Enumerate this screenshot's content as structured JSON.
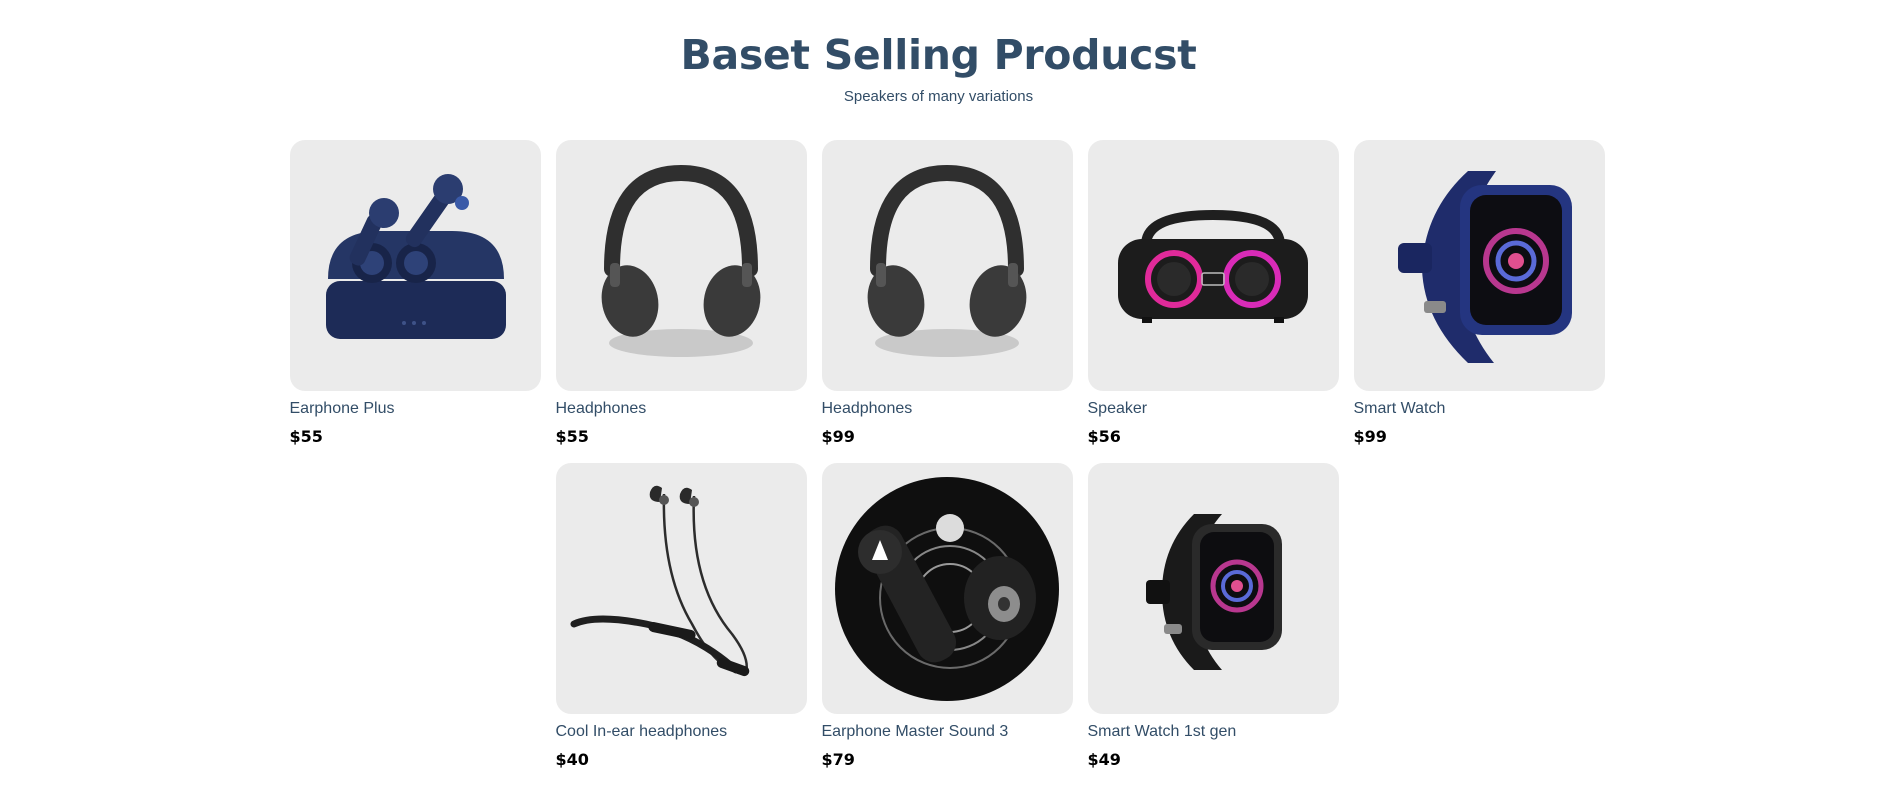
{
  "header": {
    "title": "Baset Selling Producst",
    "subtitle": "Speakers of many variations"
  },
  "products": [
    {
      "name": "Earphone Plus",
      "price": "$55",
      "icon": "earbuds-case-icon"
    },
    {
      "name": "Headphones",
      "price": "$55",
      "icon": "headphones-icon"
    },
    {
      "name": "Headphones",
      "price": "$99",
      "icon": "headphones-icon"
    },
    {
      "name": "Speaker",
      "price": "$56",
      "icon": "speaker-icon"
    },
    {
      "name": "Smart Watch",
      "price": "$99",
      "icon": "smartwatch-icon"
    },
    {
      "name": "Cool In-ear headphones",
      "price": "$40",
      "icon": "neckband-earphones-icon"
    },
    {
      "name": "Earphone Master Sound 3",
      "price": "$79",
      "icon": "earbuds-icon"
    },
    {
      "name": "Smart Watch 1st gen",
      "price": "$49",
      "icon": "smartwatch-black-icon"
    }
  ],
  "colors": {
    "heading": "#324d67",
    "card_bg": "#ebebeb",
    "price": "#000000"
  }
}
